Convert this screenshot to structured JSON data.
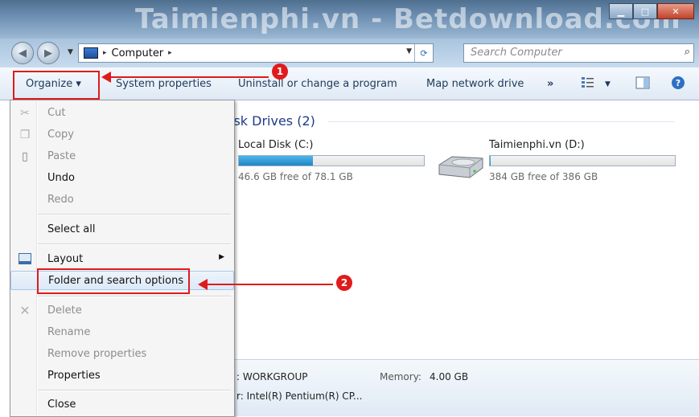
{
  "window": {
    "watermark": "Taimienphi.vn - Betdownload.com",
    "buttons": {
      "minimize": "▁",
      "maximize": "□",
      "close": "✕"
    }
  },
  "address": {
    "location": "Computer",
    "separator": "▸",
    "search_placeholder": "Search Computer"
  },
  "toolbar": {
    "organize": "Organize ▾",
    "system_properties": "System properties",
    "uninstall": "Uninstall or change a program",
    "map_drive": "Map network drive",
    "more": "»"
  },
  "content": {
    "group_title": "isk Drives (2)",
    "drives": [
      {
        "name": "Local Disk (C:)",
        "free": "46.6 GB free of 78.1 GB",
        "used_fraction": 0.4
      },
      {
        "name": "Taimienphi.vn (D:)",
        "free": "384 GB free of 386 GB",
        "used_fraction": 0.005
      }
    ]
  },
  "details": {
    "workgroup": ": WORKGROUP",
    "memory_label": "Memory:",
    "memory_value": "4.00 GB",
    "processor": "r: Intel(R) Pentium(R) CP..."
  },
  "menu": {
    "cut": "Cut",
    "copy": "Copy",
    "paste": "Paste",
    "undo": "Undo",
    "redo": "Redo",
    "select_all": "Select all",
    "layout": "Layout",
    "folder_options": "Folder and search options",
    "delete": "Delete",
    "rename": "Rename",
    "remove_properties": "Remove properties",
    "properties": "Properties",
    "close": "Close"
  },
  "annotations": {
    "step1": "1",
    "step2": "2"
  },
  "colors": {
    "annotation_red": "#e01b1b",
    "drive_bar": "#1f86c6"
  }
}
